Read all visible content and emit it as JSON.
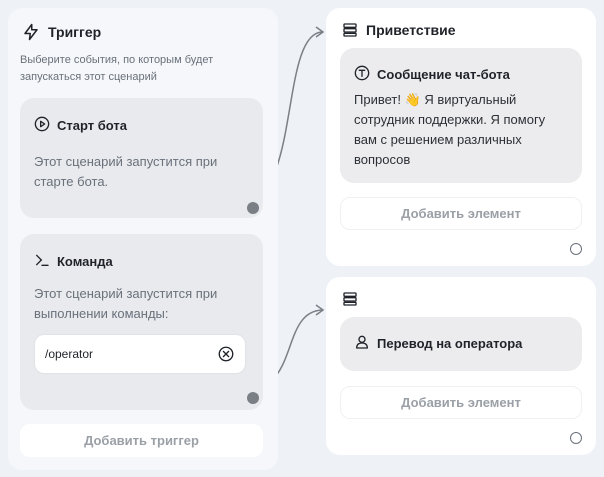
{
  "trigger": {
    "title": "Триггер",
    "description": "Выберите события, по которым будет запускаться этот сценарий",
    "start": {
      "title": "Старт бота",
      "text": "Этот сценарий запустится при старте бота."
    },
    "command": {
      "title": "Команда",
      "text": "Этот сценарий запустится при выполнении команды:",
      "value": "/operator"
    },
    "add_label": "Добавить триггер"
  },
  "greeting": {
    "title": "Приветствие",
    "message_title": "Сообщение чат-бота",
    "message_text": "Привет! 👋 Я виртуальный сотрудник поддержки. Я помогу вам с решением различных вопросов",
    "add_label": "Добавить элемент"
  },
  "operator": {
    "item_title": "Перевод на оператора",
    "add_label": "Добавить элемент"
  },
  "colors": {
    "background": "#eef2f7",
    "card": "#e8eaed",
    "connector": "#7a7f86",
    "muted_text": "#9aa0a6"
  }
}
